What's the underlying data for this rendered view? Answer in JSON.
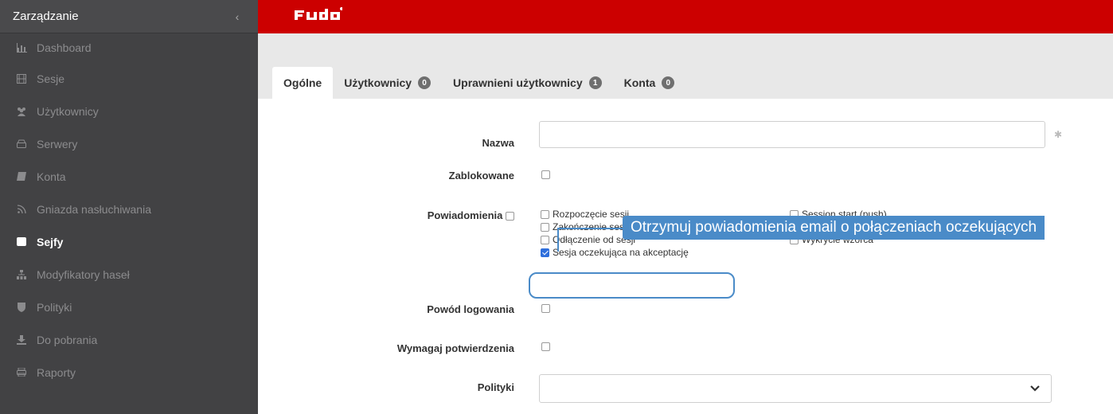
{
  "sidebar": {
    "title": "Zarządzanie",
    "collapse_icon": "chevron-left-icon",
    "items": [
      {
        "label": "Dashboard",
        "icon": "bar-chart-icon"
      },
      {
        "label": "Sesje",
        "icon": "film-icon"
      },
      {
        "label": "Użytkownicy",
        "icon": "users-icon"
      },
      {
        "label": "Serwery",
        "icon": "server-icon"
      },
      {
        "label": "Konta",
        "icon": "book-icon"
      },
      {
        "label": "Gniazda nasłuchiwania",
        "icon": "rss-icon"
      },
      {
        "label": "Sejfy",
        "icon": "safe-icon"
      },
      {
        "label": "Modyfikatory haseł",
        "icon": "sitemap-icon"
      },
      {
        "label": "Polityki",
        "icon": "shield-icon"
      },
      {
        "label": "Do pobrania",
        "icon": "download-icon"
      },
      {
        "label": "Raporty",
        "icon": "print-icon"
      }
    ],
    "active_item": "Sejfy"
  },
  "topbar": {
    "logo": "Fudo"
  },
  "tabs": [
    {
      "label": "Ogólne",
      "badge": null,
      "active": true
    },
    {
      "label": "Użytkownicy",
      "badge": "0",
      "active": false
    },
    {
      "label": "Uprawnieni użytkownicy",
      "badge": "1",
      "active": false
    },
    {
      "label": "Konta",
      "badge": "0",
      "active": false
    }
  ],
  "form": {
    "name_label": "Nazwa",
    "name_value": "",
    "blocked_label": "Zablokowane",
    "notifications_label": "Powiadomienia",
    "notifications_options": [
      {
        "label": "Rozpoczęcie sesji",
        "checked": false
      },
      {
        "label": "Zakończenie sesji",
        "checked": false
      },
      {
        "label": "Odłączenie od sesji",
        "checked": false
      },
      {
        "label": "Sesja oczekująca na akceptację",
        "checked": true
      },
      {
        "label": "Session start (push)",
        "checked": false
      },
      {
        "label": "Wykrycie wzorca",
        "checked": false
      }
    ],
    "login_reason_label": "Powód logowania",
    "require_confirmation_label": "Wymagaj potwierdzenia",
    "policies_label": "Polityki",
    "policies_value": ""
  },
  "callout": {
    "text": "Otrzymuj powiadomienia email o połączeniach oczekujących"
  },
  "colors": {
    "sidebar_bg": "#424244",
    "topbar_bg": "#cc0000",
    "callout": "#4a8bc8",
    "checkbox_checked": "#2f6fdc"
  }
}
